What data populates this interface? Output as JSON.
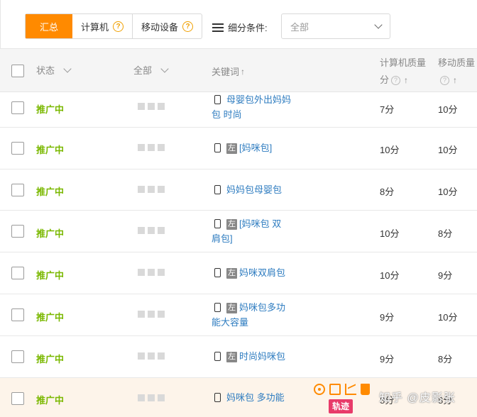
{
  "toolbar": {
    "tabs": [
      {
        "label": "汇总",
        "active": true
      },
      {
        "label": "计算机",
        "help": true
      },
      {
        "label": "移动设备",
        "help": true
      }
    ],
    "help_glyph": "?",
    "filter_label": "细分条件:",
    "filter_value": "全部"
  },
  "header": {
    "status": "状态",
    "bid": "全部",
    "keyword": "关键词",
    "up_arrow": "↑",
    "pc_quality_line1": "计算机质量",
    "pc_quality_line2": "分",
    "mobile_quality_line1": "移动质量",
    "help_glyph": "?"
  },
  "rows": [
    {
      "status": "推广中",
      "tag": "",
      "kw_line1": "母婴包外出妈妈",
      "kw_line2": "包 时尚",
      "pc": "7分",
      "mobile": "10分"
    },
    {
      "status": "推广中",
      "tag": "左",
      "kw_line1": "[妈咪包]",
      "kw_line2": "",
      "pc": "10分",
      "mobile": "10分"
    },
    {
      "status": "推广中",
      "tag": "",
      "kw_line1": "妈妈包母婴包",
      "kw_line2": "",
      "pc": "8分",
      "mobile": "10分"
    },
    {
      "status": "推广中",
      "tag": "左",
      "kw_line1": "[妈咪包 双",
      "kw_line2": "肩包]",
      "pc": "10分",
      "mobile": "8分"
    },
    {
      "status": "推广中",
      "tag": "左",
      "kw_line1": "妈咪双肩包",
      "kw_line2": "",
      "pc": "10分",
      "mobile": "9分"
    },
    {
      "status": "推广中",
      "tag": "左",
      "kw_line1": "妈咪包多功",
      "kw_line2": "能大容量",
      "pc": "9分",
      "mobile": "10分"
    },
    {
      "status": "推广中",
      "tag": "左",
      "kw_line1": "时尚妈咪包",
      "kw_line2": "",
      "pc": "9分",
      "mobile": "8分"
    },
    {
      "status": "推广中",
      "tag": "",
      "kw_line1": "妈咪包 多功能",
      "kw_line2": "",
      "pc": "8分",
      "mobile": "8分"
    }
  ],
  "row_actions": {
    "track_label": "轨迹"
  },
  "watermark": "知乎 @皮影张",
  "colors": {
    "accent": "#ff8a00",
    "status_green": "#7ab800",
    "link_blue": "#2e7cc0",
    "track_pink": "#e83b6a"
  }
}
